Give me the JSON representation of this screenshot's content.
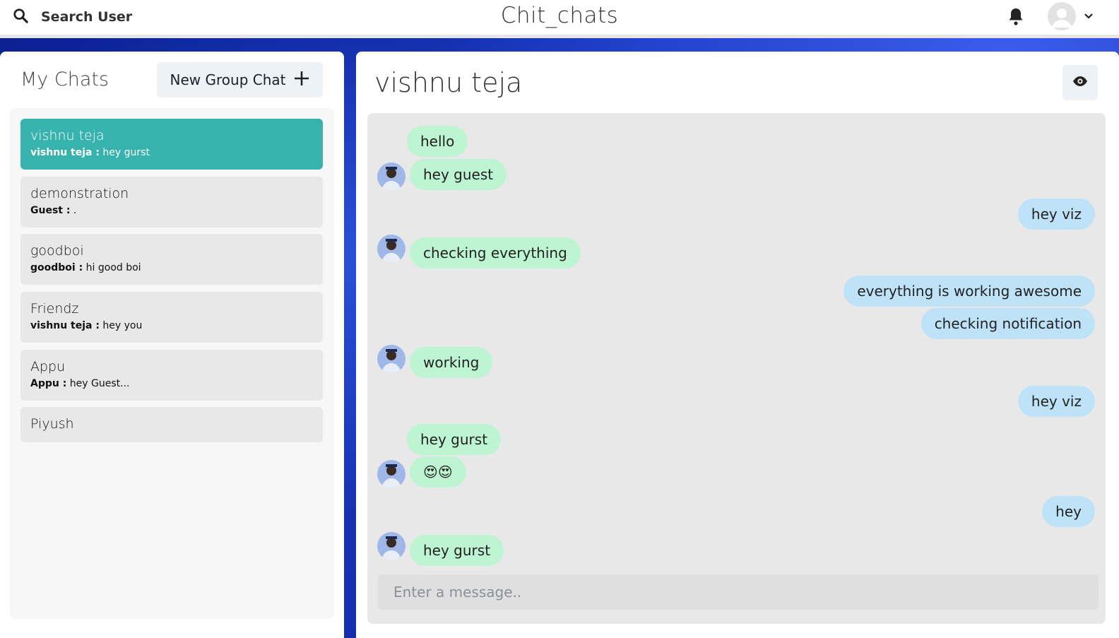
{
  "header": {
    "search_label": "Search User",
    "app_title": "Chit_chats"
  },
  "sidebar": {
    "title": "My Chats",
    "new_group_label": "New Group Chat",
    "chats": [
      {
        "name": "vishnu teja",
        "sender": "vishnu teja :",
        "message": "hey gurst",
        "active": true
      },
      {
        "name": "demonstration",
        "sender": "Guest :",
        "message": "."
      },
      {
        "name": "goodboi",
        "sender": "goodboi :",
        "message": "hi good boi"
      },
      {
        "name": "Friendz",
        "sender": "vishnu teja :",
        "message": "hey you"
      },
      {
        "name": "Appu",
        "sender": "Appu :",
        "message": "hey Guest..."
      },
      {
        "name": "Piyush"
      }
    ]
  },
  "chat": {
    "title": "vishnu teja",
    "messages": [
      {
        "text": "hello",
        "side": "in"
      },
      {
        "text": "hey guest",
        "side": "in"
      },
      {
        "text": "hey viz",
        "side": "out"
      },
      {
        "text": "checking everything",
        "side": "in"
      },
      {
        "text": "everything is working awesome",
        "side": "out"
      },
      {
        "text": "checking notification",
        "side": "out"
      },
      {
        "text": "working",
        "side": "in"
      },
      {
        "text": "hey viz",
        "side": "out"
      },
      {
        "text": "hey gurst",
        "side": "in"
      },
      {
        "text": "😍😍",
        "side": "in"
      },
      {
        "text": "hey",
        "side": "out"
      },
      {
        "text": "hey gurst",
        "side": "in"
      }
    ],
    "input_placeholder": "Enter a message.."
  },
  "colors": {
    "active_chat": "#38b2ac",
    "incoming_bubble": "#bdf4d1",
    "outgoing_bubble": "#bee3f8"
  }
}
